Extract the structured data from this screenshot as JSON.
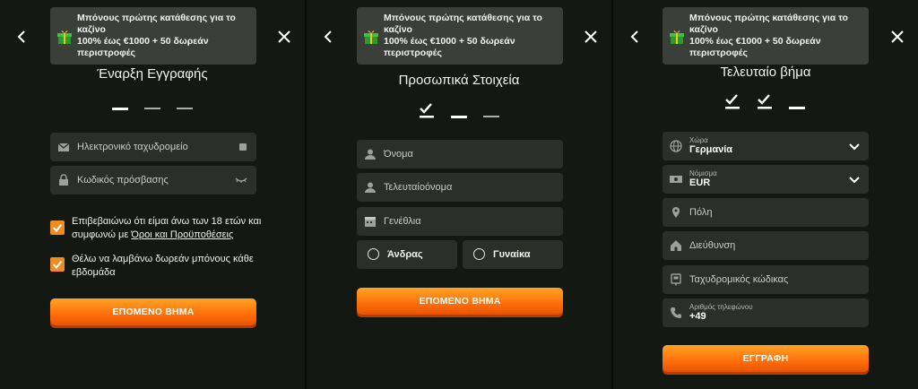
{
  "banner": {
    "line1": "Μπόνους πρώτης κατάθεσης για το καζίνο",
    "line2": "100% έως €1000 + 50 δωρεάν περιστροφές"
  },
  "step1": {
    "title": "Έναρξη Εγγραφής",
    "email_placeholder": "Ηλεκτρονικό ταχυδρομείο",
    "password_placeholder": "Κωδικός πρόσβασης",
    "age_text": "Επιβεβαιώνω ότι είμαι άνω των 18 ετών και συμφωνώ με ",
    "terms_link": "Όροι και Προϋποθέσεις",
    "bonus_text": "Θέλω να λαμβάνω δωρεάν μπόνους κάθε εβδομάδα",
    "next": "ΕΠΟΜΕΝΟ ΒΗΜΑ"
  },
  "step2": {
    "title": "Προσωπικά Στοιχεία",
    "first_name": "Όνομα",
    "last_name": "Τελευταίοόνομα",
    "birthdate": "Γενέθλια",
    "male": "Άνδρας",
    "female": "Γυναίκα",
    "next": "ΕΠΟΜΕΝΟ ΒΗΜΑ"
  },
  "step3": {
    "title": "Τελευταίο βήμα",
    "country_label": "Χώρα",
    "country_value": "Γερμανία",
    "currency_label": "Νόμισμα",
    "currency_value": "EUR",
    "city": "Πόλη",
    "address": "Διεύθυνση",
    "postal": "Ταχυδρομικός κώδικας",
    "phone_label": "Αριθμός τηλεφώνου",
    "phone_value": "+49",
    "submit": "ΕΓΓΡΑΦΗ"
  },
  "colors": {
    "accent": "#ff7a12",
    "field": "#2a2f29",
    "banner": "#3a3f39"
  }
}
